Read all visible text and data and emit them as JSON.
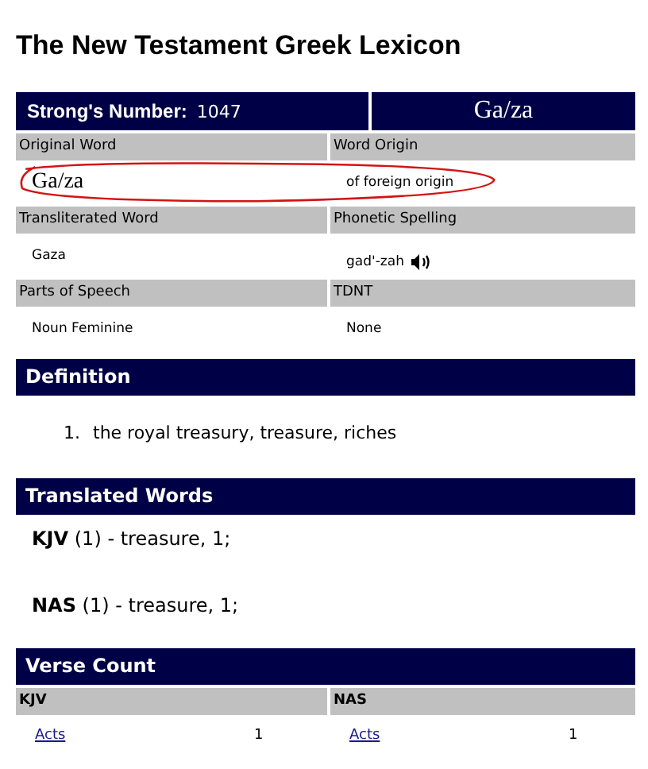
{
  "page_title": "The New Testament Greek Lexicon",
  "header": {
    "label": "Strong's Number:",
    "number": "1047",
    "word": "Ga/za"
  },
  "fields": [
    {
      "label": "Original Word",
      "value": "Ga/za",
      "kind": "greek",
      "circled": true
    },
    {
      "label": "Word Origin",
      "value": "of foreign origin",
      "kind": "text",
      "circled": true
    },
    {
      "label": "Transliterated Word",
      "value": "Gaza",
      "kind": "text",
      "circled": false
    },
    {
      "label": "Phonetic Spelling",
      "value": "gad'-zah",
      "kind": "audio",
      "circled": false
    },
    {
      "label": "Parts of Speech",
      "value": "Noun Feminine",
      "kind": "text",
      "circled": false
    },
    {
      "label": "TDNT",
      "value": "None",
      "kind": "text",
      "circled": false
    }
  ],
  "definition": {
    "title": "Definition",
    "items": [
      {
        "marker": "1.",
        "text": "the royal treasury, treasure, riches"
      }
    ]
  },
  "translated_words": {
    "title": "Translated Words",
    "lines": [
      "**KJV** (1) - treasure, 1;",
      "**NAS** (1) - treasure, 1;"
    ]
  },
  "verse_count": {
    "title": "Verse Count",
    "columns": [
      {
        "heading": "KJV",
        "rows": [
          {
            "book": "Acts",
            "count": "1"
          }
        ]
      },
      {
        "heading": "NAS",
        "rows": [
          {
            "book": "Acts",
            "count": "1"
          }
        ]
      }
    ]
  }
}
